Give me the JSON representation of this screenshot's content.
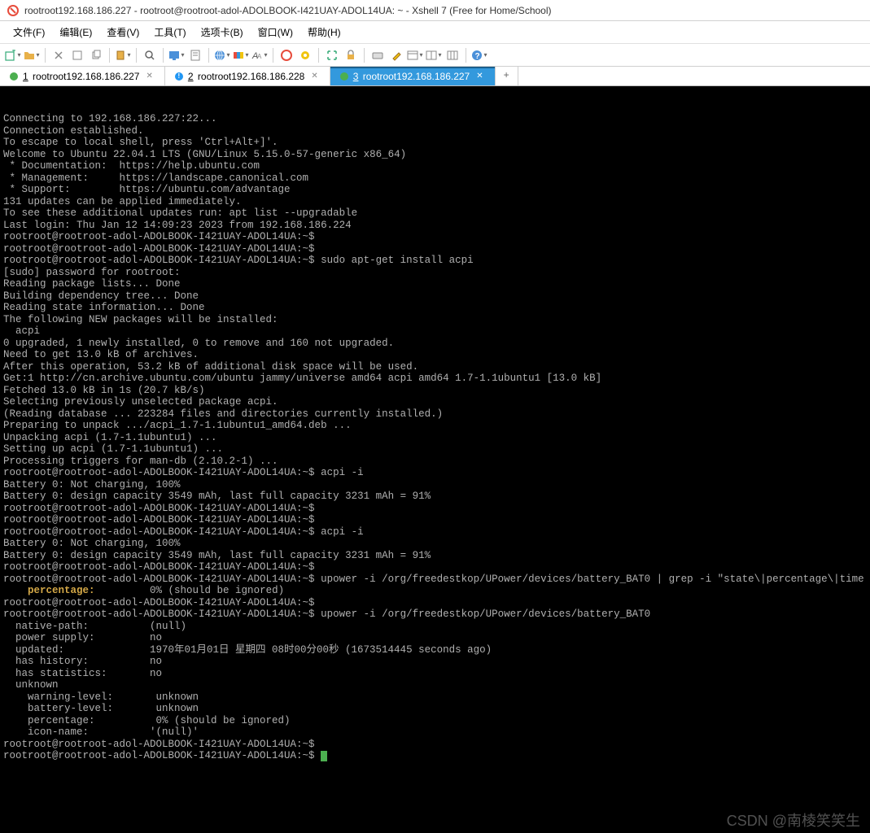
{
  "window": {
    "title": "rootroot192.168.186.227 - rootroot@rootroot-adol-ADOLBOOK-I421UAY-ADOL14UA: ~ - Xshell 7 (Free for Home/School)"
  },
  "menus": [
    "文件(F)",
    "编辑(E)",
    "查看(V)",
    "工具(T)",
    "选项卡(B)",
    "窗口(W)",
    "帮助(H)"
  ],
  "toolbarIcons": [
    "new-session-icon",
    "open-icon",
    "sep",
    "cut-icon",
    "copy-icon",
    "paste-icon",
    "sep",
    "find-icon",
    "sep",
    "terminal-type-icon",
    "prop-icon",
    "sep",
    "globe-icon",
    "color-scheme-icon",
    "font-icon",
    "sep",
    "red-circle-icon",
    "gear-yellow-icon",
    "sep",
    "fullscreen-icon",
    "lock-icon",
    "sep",
    "keyboard-icon",
    "highlighter-icon",
    "layout1-icon",
    "layout2-icon",
    "layout3-icon",
    "sep",
    "help-icon"
  ],
  "tabs": [
    {
      "num": "1",
      "label": "rootroot192.168.186.227",
      "icon": "green",
      "active": false
    },
    {
      "num": "2",
      "label": "rootroot192.168.186.228",
      "icon": "blue-exclaim",
      "active": false
    },
    {
      "num": "3",
      "label": "rootroot192.168.186.227",
      "icon": "green",
      "active": true
    }
  ],
  "terminal": {
    "lines": [
      "Connecting to 192.168.186.227:22...",
      "Connection established.",
      "To escape to local shell, press 'Ctrl+Alt+]'.",
      "",
      "Welcome to Ubuntu 22.04.1 LTS (GNU/Linux 5.15.0-57-generic x86_64)",
      "",
      " * Documentation:  https://help.ubuntu.com",
      " * Management:     https://landscape.canonical.com",
      " * Support:        https://ubuntu.com/advantage",
      "",
      "131 updates can be applied immediately.",
      "To see these additional updates run: apt list --upgradable",
      "",
      "Last login: Thu Jan 12 14:09:23 2023 from 192.168.186.224",
      "rootroot@rootroot-adol-ADOLBOOK-I421UAY-ADOL14UA:~$ ",
      "rootroot@rootroot-adol-ADOLBOOK-I421UAY-ADOL14UA:~$ ",
      "rootroot@rootroot-adol-ADOLBOOK-I421UAY-ADOL14UA:~$ sudo apt-get install acpi",
      "[sudo] password for rootroot: ",
      "Reading package lists... Done",
      "Building dependency tree... Done",
      "Reading state information... Done",
      "The following NEW packages will be installed:",
      "  acpi",
      "0 upgraded, 1 newly installed, 0 to remove and 160 not upgraded.",
      "Need to get 13.0 kB of archives.",
      "After this operation, 53.2 kB of additional disk space will be used.",
      "Get:1 http://cn.archive.ubuntu.com/ubuntu jammy/universe amd64 acpi amd64 1.7-1.1ubuntu1 [13.0 kB]",
      "Fetched 13.0 kB in 1s (20.7 kB/s)",
      "Selecting previously unselected package acpi.",
      "(Reading database ... 223284 files and directories currently installed.)",
      "Preparing to unpack .../acpi_1.7-1.1ubuntu1_amd64.deb ...",
      "Unpacking acpi (1.7-1.1ubuntu1) ...",
      "Setting up acpi (1.7-1.1ubuntu1) ...",
      "Processing triggers for man-db (2.10.2-1) ...",
      "rootroot@rootroot-adol-ADOLBOOK-I421UAY-ADOL14UA:~$ acpi -i",
      "Battery 0: Not charging, 100%",
      "Battery 0: design capacity 3549 mAh, last full capacity 3231 mAh = 91%",
      "rootroot@rootroot-adol-ADOLBOOK-I421UAY-ADOL14UA:~$ ",
      "rootroot@rootroot-adol-ADOLBOOK-I421UAY-ADOL14UA:~$ ",
      "rootroot@rootroot-adol-ADOLBOOK-I421UAY-ADOL14UA:~$ acpi -i",
      "Battery 0: Not charging, 100%",
      "Battery 0: design capacity 3549 mAh, last full capacity 3231 mAh = 91%",
      "rootroot@rootroot-adol-ADOLBOOK-I421UAY-ADOL14UA:~$ ",
      "rootroot@rootroot-adol-ADOLBOOK-I421UAY-ADOL14UA:~$ upower -i /org/freedestkop/UPower/devices/battery_BAT0 | grep -i \"state\\|percentage\\|time to empty\""
    ],
    "yellowLine": {
      "prefix": "    ",
      "label": "percentage:",
      "suffix": "         0% (should be ignored)"
    },
    "linesAfter": [
      "rootroot@rootroot-adol-ADOLBOOK-I421UAY-ADOL14UA:~$ ",
      "rootroot@rootroot-adol-ADOLBOOK-I421UAY-ADOL14UA:~$ upower -i /org/freedestkop/UPower/devices/battery_BAT0",
      "  native-path:          (null)",
      "  power supply:         no",
      "  updated:              1970年01月01日 星期四 08时00分00秒 (1673514445 seconds ago)",
      "  has history:          no",
      "  has statistics:       no",
      "  unknown",
      "    warning-level:       unknown",
      "    battery-level:       unknown",
      "    percentage:          0% (should be ignored)",
      "    icon-name:          '(null)'",
      "",
      "rootroot@rootroot-adol-ADOLBOOK-I421UAY-ADOL14UA:~$ ",
      "rootroot@rootroot-adol-ADOLBOOK-I421UAY-ADOL14UA:~$ "
    ],
    "watermark": "CSDN @南棱笑笑生"
  }
}
